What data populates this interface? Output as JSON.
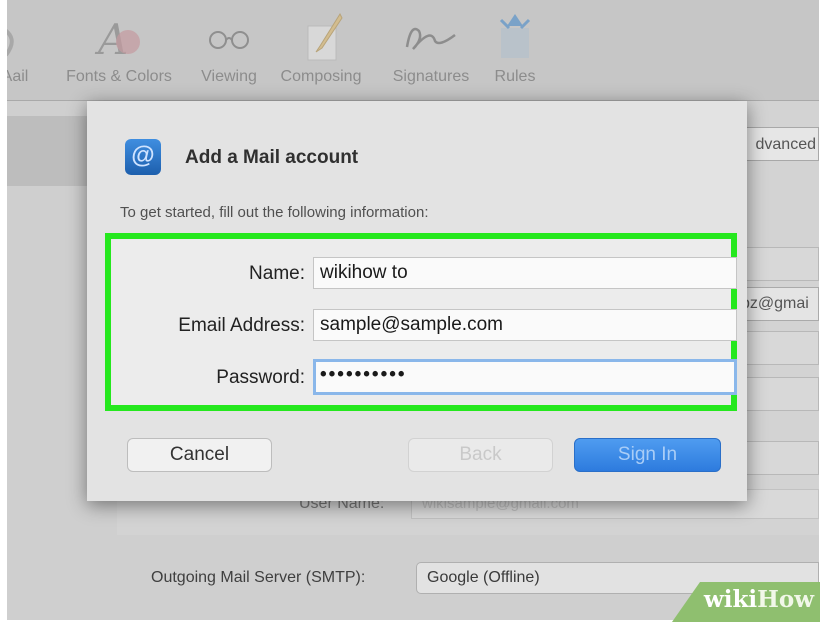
{
  "toolbar": {
    "items": [
      {
        "label": "Mail",
        "icon": "mail-icon"
      },
      {
        "label": "Fonts & Colors",
        "icon": "fonts-colors-icon"
      },
      {
        "label": "Viewing",
        "icon": "glasses-icon"
      },
      {
        "label": "Composing",
        "icon": "pencil-icon"
      },
      {
        "label": "Signatures",
        "icon": "signature-icon"
      },
      {
        "label": "Rules",
        "icon": "rules-icon"
      }
    ],
    "visible_labels": [
      "Aail",
      "Fonts & Colors",
      "Viewing",
      "Composing",
      "Signatures",
      "Rules"
    ]
  },
  "background": {
    "advanced_tab": "dvanced",
    "email_partial": "bz@gmai",
    "user_name_label": "User Name:",
    "user_name_value": "wikisample@gmail.com",
    "smtp_label": "Outgoing Mail Server (SMTP):",
    "smtp_value": "Google (Offline)"
  },
  "dialog": {
    "title": "Add a Mail account",
    "instructions": "To get started, fill out the following information:",
    "name_label": "Name:",
    "name_value": "wikihow to",
    "email_label": "Email Address:",
    "email_value": "sample@sample.com",
    "password_label": "Password:",
    "password_value": "••••••••••",
    "cancel": "Cancel",
    "back": "Back",
    "sign_in": "Sign In"
  },
  "colors": {
    "highlight": "#25e81e",
    "primary_button": "#2d7bde",
    "watermark": "#8fbf6f"
  },
  "watermark": {
    "part1": "wiki",
    "part2": "How"
  }
}
